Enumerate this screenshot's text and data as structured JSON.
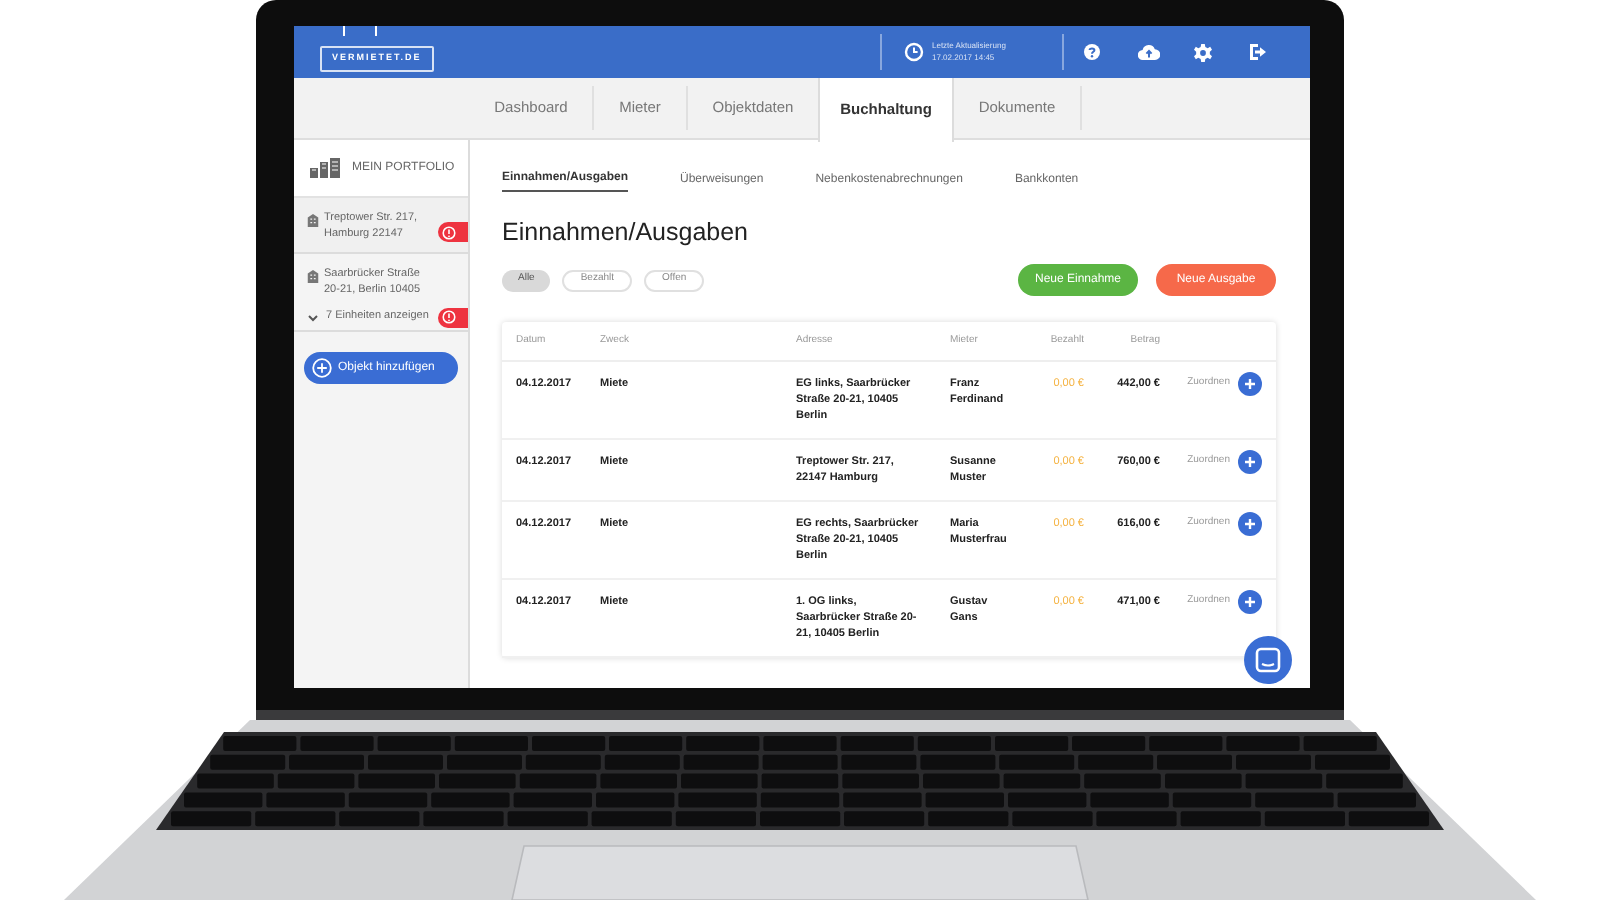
{
  "header": {
    "logo": "VERMIETET.DE",
    "update_label": "Letzte Aktualisierung",
    "update_time": "17.02.2017 14:45"
  },
  "tabs": [
    {
      "label": "Dashboard",
      "selected": false
    },
    {
      "label": "Mieter",
      "selected": false
    },
    {
      "label": "Objektdaten",
      "selected": false
    },
    {
      "label": "Buchhaltung",
      "selected": true
    },
    {
      "label": "Dokumente",
      "selected": false
    }
  ],
  "sidebar": {
    "title": "MEIN PORTFOLIO",
    "properties": [
      {
        "address": "Treptower Str. 217, Hamburg 22147",
        "alert": true
      },
      {
        "address": "Saarbrücker Straße 20-21, Berlin 10405",
        "alert": false
      }
    ],
    "units_toggle": {
      "label": "7 Einheiten anzeigen",
      "expanded": false,
      "alert": true
    },
    "add_button": "Objekt hinzufügen"
  },
  "subtabs": [
    {
      "label": "Einnahmen/Ausgaben",
      "selected": true
    },
    {
      "label": "Überweisungen",
      "selected": false
    },
    {
      "label": "Nebenkostenabrechnungen",
      "selected": false
    },
    {
      "label": "Bankkonten",
      "selected": false
    }
  ],
  "heading": "Einnahmen/Ausgaben",
  "filters": [
    {
      "label": "Alle",
      "selected": true
    },
    {
      "label": "Bezahlt",
      "selected": false
    },
    {
      "label": "Offen",
      "selected": false
    }
  ],
  "actions": [
    {
      "label": "Neue Einnahme",
      "kind": "income"
    },
    {
      "label": "Neue Ausgabe",
      "kind": "expense"
    }
  ],
  "table": {
    "columns": [
      "Datum",
      "Zweck",
      "Adresse",
      "Mieter",
      "Bezahlt",
      "Betrag"
    ],
    "rows": [
      {
        "date": "04.12.2017",
        "purpose": "Miete",
        "address": "EG links, Saarbrücker Straße 20-21, 10405 Berlin",
        "tenant": "Franz Ferdinand",
        "paid": "0,00 €",
        "amount": "442,00 €",
        "action": "Zuordnen"
      },
      {
        "date": "04.12.2017",
        "purpose": "Miete",
        "address": "Treptower Str. 217, 22147 Hamburg",
        "tenant": "Susanne Muster",
        "paid": "0,00 €",
        "amount": "760,00 €",
        "action": "Zuordnen"
      },
      {
        "date": "04.12.2017",
        "purpose": "Miete",
        "address": "EG rechts, Saarbrücker Straße 20-21, 10405 Berlin",
        "tenant": "Maria Musterfrau",
        "paid": "0,00 €",
        "amount": "616,00 €",
        "action": "Zuordnen"
      },
      {
        "date": "04.12.2017",
        "purpose": "Miete",
        "address": "1. OG links, Saarbrücker Straße 20-21, 10405 Berlin",
        "tenant": "Gustav Gans",
        "paid": "0,00 €",
        "amount": "471,00 €",
        "action": "Zuordnen"
      }
    ]
  }
}
